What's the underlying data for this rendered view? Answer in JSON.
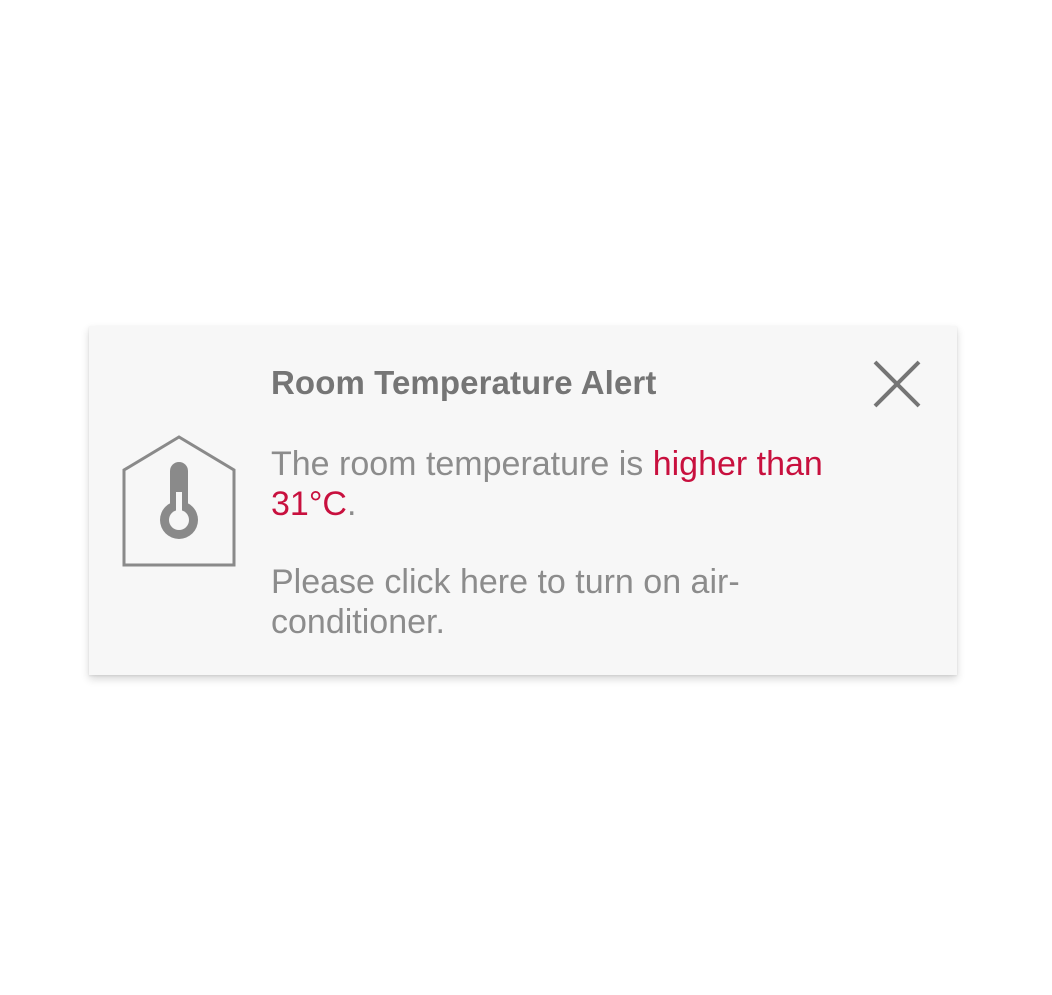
{
  "alert": {
    "title": "Room Temperature Alert",
    "message_prefix": "The room temperature is ",
    "message_highlight": "higher than 31°C",
    "message_suffix": ".",
    "action_text": "Please click here to turn on air-conditioner.",
    "icon": "house-thermometer-icon",
    "close_icon": "close-icon"
  },
  "colors": {
    "title": "#757575",
    "text": "#8c8c8c",
    "highlight": "#c8103e",
    "icon": "#8a8a8a",
    "card_background": "#f7f7f7"
  }
}
